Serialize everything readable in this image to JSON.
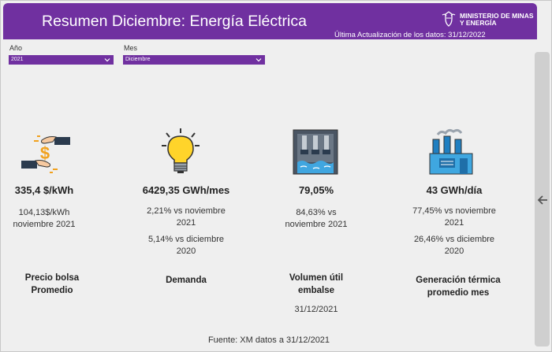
{
  "header": {
    "title": "Resumen Diciembre: Energía Eléctrica",
    "last_update": "Última Actualización de los datos: 31/12/2022",
    "org_line1": "MINISTERIO DE MINAS",
    "org_line2": "Y ENERGÍA",
    "colors": {
      "header_bg": "#7030a0",
      "filter_bg": "#7030a0",
      "canvas_bg": "#efefef"
    }
  },
  "filters": {
    "year_label": "Año",
    "year_value": "2021",
    "month_label": "Mes",
    "month_value": "Diciembre"
  },
  "kpis": [
    {
      "icon": "money-exchange-icon",
      "value": "335,4 $/kWh",
      "comparisons": [
        [
          "104,13$/kWh",
          "noviembre 2021"
        ]
      ],
      "name_lines": [
        "Precio bolsa",
        "Promedio"
      ]
    },
    {
      "icon": "lightbulb-icon",
      "value": "6429,35 GWh/mes",
      "comparisons": [
        [
          "2,21% vs noviembre",
          "2021"
        ],
        [
          "5,14% vs diciembre",
          "2020"
        ]
      ],
      "name_lines": [
        "Demanda"
      ]
    },
    {
      "icon": "dam-reservoir-icon",
      "value": "79,05%",
      "comparisons": [
        [
          "84,63% vs",
          "noviembre 2021"
        ]
      ],
      "name_lines": [
        "Volumen útil",
        "embalse"
      ],
      "date": "31/12/2021"
    },
    {
      "icon": "thermal-plant-icon",
      "value": "43 GWh/día",
      "comparisons": [
        [
          "77,45% vs noviembre",
          "2021"
        ],
        [
          "26,46% vs diciembre",
          "2020"
        ]
      ],
      "name_lines": [
        "Generación térmica",
        "promedio mes"
      ]
    }
  ],
  "footer": {
    "source": "Fuente: XM datos a 31/12/2021"
  }
}
